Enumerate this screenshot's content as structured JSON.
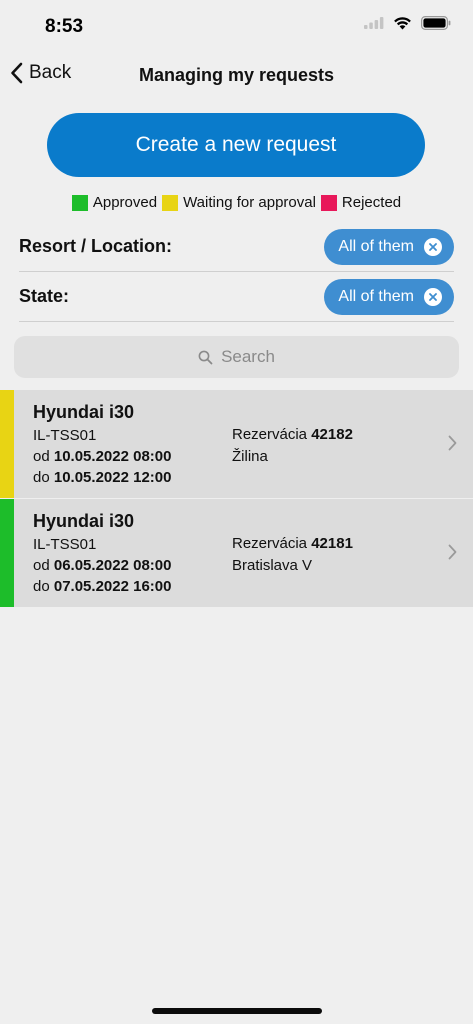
{
  "status": {
    "time": "8:53"
  },
  "nav": {
    "back_label": "Back",
    "title": "Managing my requests"
  },
  "create_label": "Create a new request",
  "legend": [
    {
      "label": "Approved",
      "color": "#1dbd2a"
    },
    {
      "label": "Waiting for approval",
      "color": "#e8d414"
    },
    {
      "label": "Rejected",
      "color": "#e8185a"
    }
  ],
  "filters": {
    "location": {
      "label": "Resort / Location:",
      "value": "All of them"
    },
    "state": {
      "label": "State:",
      "value": "All of them"
    }
  },
  "search": {
    "placeholder": "Search"
  },
  "requests": [
    {
      "status_color": "#e8d414",
      "car": "Hyundai i30",
      "plate": "IL-TSS01",
      "from_prefix": "od",
      "from": "10.05.2022 08:00",
      "to_prefix": "do",
      "to": "10.05.2022 12:00",
      "reservation_label": "Rezervácia",
      "reservation_number": "42182",
      "location": "Žilina"
    },
    {
      "status_color": "#1dbd2a",
      "car": "Hyundai i30",
      "plate": "IL-TSS01",
      "from_prefix": "od",
      "from": "06.05.2022 08:00",
      "to_prefix": "do",
      "to": "07.05.2022 16:00",
      "reservation_label": "Rezervácia",
      "reservation_number": "42181",
      "location": "Bratislava V"
    }
  ]
}
